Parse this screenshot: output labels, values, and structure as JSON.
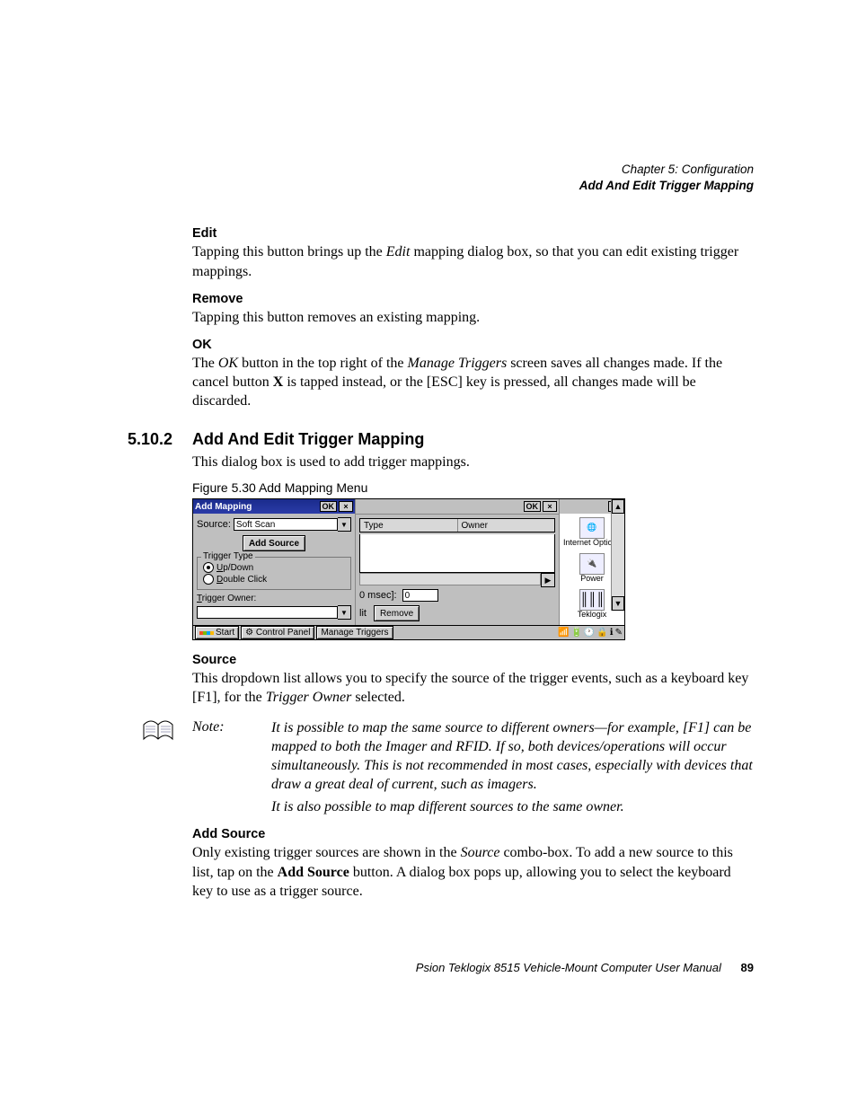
{
  "header": {
    "chapter": "Chapter 5: Configuration",
    "section": "Add And Edit Trigger Mapping"
  },
  "edit": {
    "h": "Edit",
    "p1a": "Tapping this button brings up the ",
    "p1i": "Edit",
    "p1b": " mapping dialog box, so that you can edit existing trigger mappings."
  },
  "remove": {
    "h": "Remove",
    "p": "Tapping this button removes an existing mapping."
  },
  "ok": {
    "h": "OK",
    "p1a": "The ",
    "p1i1": "OK",
    "p1b": " button in the top right of the ",
    "p1i2": "Manage Triggers",
    "p1c": " screen saves all changes made. If the cancel button ",
    "p1bold": "X",
    "p1d": " is tapped instead, or the [ESC] key is pressed, all changes made will be discarded."
  },
  "sec": {
    "num": "5.10.2",
    "title": "Add And Edit Trigger Mapping"
  },
  "intro": "This dialog box is used to add trigger mappings.",
  "figcap": "Figure 5.30 Add Mapping Menu",
  "shot": {
    "title": "Add Mapping",
    "ok": "OK",
    "x": "×",
    "source_lbl": "Source:",
    "source_val": "Soft Scan",
    "addsrc": "Add Source",
    "group": "Trigger Type",
    "r1a": "U",
    "r1b": "p/Down",
    "r2a": "D",
    "r2b": "ouble Click",
    "towner_a": "T",
    "towner_b": "rigger Owner:",
    "col1": "Type",
    "col2": "Owner",
    "msec": "0 msec]:",
    "msec_val": "0",
    "lit": "lit",
    "removebtn": "Remove",
    "cp1": "Internet Options",
    "cp2": "Power",
    "cp3": "Teklogix",
    "start": "Start",
    "tb1": "Control Panel",
    "tb2": "Manage Triggers"
  },
  "source": {
    "h": "Source",
    "p1a": "This dropdown list allows you to specify the source of the trigger events, such as a keyboard key [F1], for the ",
    "p1i": "Trigger Owner",
    "p1b": " selected."
  },
  "note": {
    "label": "Note:",
    "t1": "It is possible to map the same source to different owners—for example, [F1] can be mapped to both the Imager and RFID. If so, both devices/operations will occur simultaneously. This is not recommended in most cases, especially with devices that draw a great deal of current, such as imagers.",
    "t2": "It is also possible to map different sources to the same owner."
  },
  "addsource": {
    "h": "Add Source",
    "p1a": "Only existing trigger sources are shown in the ",
    "p1i": "Source",
    "p1b": " combo-box. To add a new source to this list, tap on the ",
    "p1bold": "Add Source",
    "p1c": " button. A dialog box pops up, allowing you to select the keyboard key to use as a trigger source."
  },
  "footer": {
    "text": "Psion Teklogix 8515 Vehicle-Mount Computer User Manual",
    "page": "89"
  }
}
